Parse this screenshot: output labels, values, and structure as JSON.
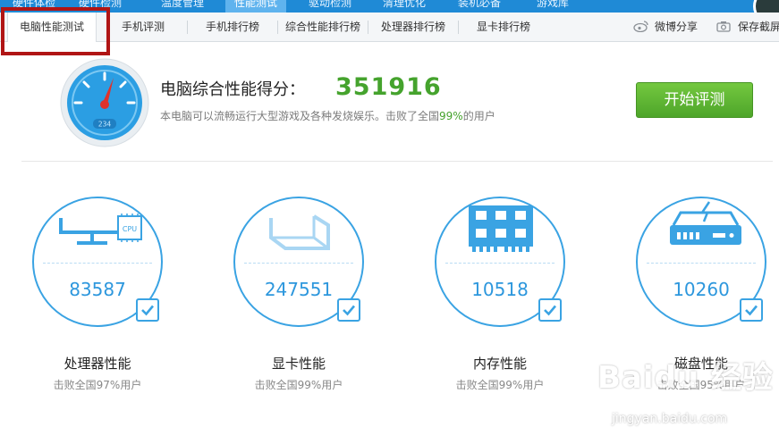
{
  "top_nav": [
    "硬件体检",
    "硬件检测",
    "温度管理",
    "性能测试",
    "驱动检测",
    "清理优化",
    "装机必备",
    "游戏库"
  ],
  "tabs": [
    "电脑性能测试",
    "手机评测",
    "手机排行榜",
    "综合性能排行榜",
    "处理器排行榜",
    "显卡排行榜"
  ],
  "share": {
    "weibo": "微博分享",
    "screenshot": "保存截屏"
  },
  "score": {
    "title": "电脑综合性能得分：",
    "value": "351916",
    "gauge_label": "234",
    "subtitle_pre": "本电脑可以流畅运行大型游戏及各种发烧娱乐。击败了全国",
    "subtitle_pct": "99%",
    "subtitle_post": "的用户"
  },
  "start_button": "开始评测",
  "components": [
    {
      "icon": "cpu-icon",
      "value": "83587",
      "label": "处理器性能",
      "sub": "击败全国97%用户"
    },
    {
      "icon": "gpu-icon",
      "value": "247551",
      "label": "显卡性能",
      "sub": "击败全国99%用户"
    },
    {
      "icon": "memory-icon",
      "value": "10518",
      "label": "内存性能",
      "sub": "击败全国99%用户"
    },
    {
      "icon": "disk-icon",
      "value": "10260",
      "label": "磁盘性能",
      "sub": "击败全国95%用户"
    }
  ],
  "watermark": {
    "logo": "Baidu 经验",
    "url": "jingyan.baidu.com"
  },
  "colors": {
    "accent": "#2d97dd",
    "green": "#45a32d",
    "red": "#b01515"
  }
}
